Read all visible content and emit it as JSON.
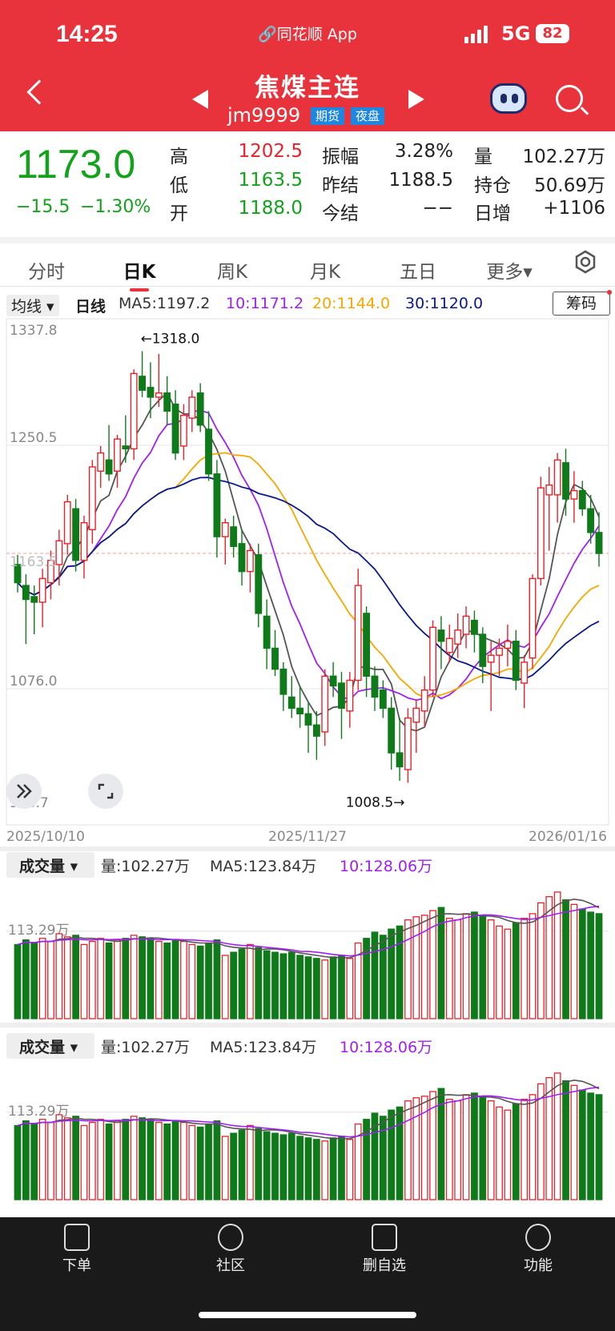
{
  "status_bar": {
    "time": "14:25",
    "app": "🔗同花顺 App",
    "network": "5G",
    "battery": "82"
  },
  "nav": {
    "title": "焦煤主连",
    "code": "jm9999",
    "tag_futures": "期货",
    "tag_night": "夜盘"
  },
  "quote": {
    "price": "1173.0",
    "change": "−15.5",
    "change_pct": "−1.30%",
    "rows": [
      {
        "l1": "高",
        "v1": "1202.5",
        "c1": "red",
        "l2": "振幅",
        "v2": "3.28%",
        "c2": "blk",
        "l3": "量",
        "v3": "102.27万",
        "c3": "blk"
      },
      {
        "l1": "低",
        "v1": "1163.5",
        "c1": "green",
        "l2": "昨结",
        "v2": "1188.5",
        "c2": "blk",
        "l3": "持仓",
        "v3": "50.69万",
        "c3": "blk"
      },
      {
        "l1": "开",
        "v1": "1188.0",
        "c1": "green",
        "l2": "今结",
        "v2": "−−",
        "c2": "blk",
        "l3": "日增",
        "v3": "+1106",
        "c3": "blk"
      }
    ]
  },
  "tabs": [
    "分时",
    "日K",
    "周K",
    "月K",
    "五日",
    "更多▾"
  ],
  "ma_bar": {
    "dropdown": "均线 ▾",
    "period": "日线",
    "ma5": "MA5:1197.2",
    "ma10": "10:1171.2",
    "ma20": "20:1144.0",
    "ma30": "30:1120.0",
    "chips": "筹码"
  },
  "colors": {
    "up": "#e8222b",
    "down": "#0f7a1a",
    "ma5": "#555555",
    "ma10": "#a020f0",
    "ma20": "#f5a800",
    "ma30": "#0a1a8a"
  },
  "chart_data": {
    "type": "candlestick",
    "ylim": [
      988.7,
      1337.8
    ],
    "y_ticks": [
      "1337.8",
      "1250.5",
      "1076.0",
      "988.7"
    ],
    "x_labels": [
      "2025/10/10",
      "2025/11/27",
      "2026/01/16"
    ],
    "annotations": {
      "high": "←1318.0",
      "low": "1008.5→",
      "last": "1163.5"
    },
    "ohlc": [
      [
        1165,
        1172,
        1145,
        1152
      ],
      [
        1150,
        1158,
        1108,
        1140
      ],
      [
        1142,
        1150,
        1115,
        1138
      ],
      [
        1138,
        1162,
        1120,
        1155
      ],
      [
        1152,
        1175,
        1140,
        1168
      ],
      [
        1165,
        1190,
        1150,
        1182
      ],
      [
        1180,
        1215,
        1172,
        1210
      ],
      [
        1205,
        1212,
        1160,
        1168
      ],
      [
        1168,
        1200,
        1155,
        1195
      ],
      [
        1190,
        1240,
        1180,
        1235
      ],
      [
        1232,
        1250,
        1220,
        1245
      ],
      [
        1240,
        1265,
        1225,
        1230
      ],
      [
        1232,
        1258,
        1220,
        1255
      ],
      [
        1250,
        1272,
        1238,
        1248
      ],
      [
        1248,
        1305,
        1240,
        1302
      ],
      [
        1300,
        1318,
        1285,
        1290
      ],
      [
        1292,
        1310,
        1270,
        1285
      ],
      [
        1285,
        1316,
        1278,
        1288
      ],
      [
        1288,
        1300,
        1265,
        1275
      ],
      [
        1280,
        1290,
        1240,
        1245
      ],
      [
        1250,
        1280,
        1240,
        1272
      ],
      [
        1270,
        1290,
        1260,
        1285
      ],
      [
        1288,
        1295,
        1260,
        1265
      ],
      [
        1262,
        1275,
        1225,
        1230
      ],
      [
        1230,
        1240,
        1170,
        1185
      ],
      [
        1185,
        1198,
        1165,
        1195
      ],
      [
        1192,
        1200,
        1170,
        1178
      ],
      [
        1180,
        1190,
        1150,
        1160
      ],
      [
        1160,
        1180,
        1145,
        1175
      ],
      [
        1172,
        1180,
        1120,
        1130
      ],
      [
        1128,
        1140,
        1090,
        1105
      ],
      [
        1105,
        1118,
        1085,
        1090
      ],
      [
        1090,
        1095,
        1060,
        1072
      ],
      [
        1070,
        1085,
        1055,
        1062
      ],
      [
        1062,
        1078,
        1048,
        1058
      ],
      [
        1058,
        1066,
        1030,
        1050
      ],
      [
        1050,
        1060,
        1025,
        1042
      ],
      [
        1045,
        1090,
        1035,
        1085
      ],
      [
        1085,
        1095,
        1070,
        1078
      ],
      [
        1080,
        1088,
        1040,
        1062
      ],
      [
        1060,
        1088,
        1048,
        1082
      ],
      [
        1082,
        1162,
        1075,
        1150
      ],
      [
        1130,
        1135,
        1070,
        1085
      ],
      [
        1085,
        1092,
        1060,
        1070
      ],
      [
        1075,
        1082,
        1055,
        1062
      ],
      [
        1062,
        1070,
        1018,
        1030
      ],
      [
        1030,
        1055,
        1010,
        1020
      ],
      [
        1018,
        1062,
        1008.5,
        1055
      ],
      [
        1052,
        1068,
        1030,
        1062
      ],
      [
        1060,
        1085,
        1048,
        1075
      ],
      [
        1075,
        1125,
        1070,
        1120
      ],
      [
        1118,
        1128,
        1090,
        1110
      ],
      [
        1102,
        1122,
        1095,
        1112
      ],
      [
        1108,
        1130,
        1098,
        1118
      ],
      [
        1115,
        1135,
        1105,
        1128
      ],
      [
        1125,
        1132,
        1102,
        1115
      ],
      [
        1115,
        1120,
        1080,
        1092
      ],
      [
        1095,
        1110,
        1060,
        1100
      ],
      [
        1100,
        1112,
        1085,
        1105
      ],
      [
        1105,
        1122,
        1092,
        1110
      ],
      [
        1110,
        1118,
        1075,
        1082
      ],
      [
        1080,
        1100,
        1062,
        1095
      ],
      [
        1098,
        1158,
        1090,
        1155
      ],
      [
        1155,
        1228,
        1150,
        1220
      ],
      [
        1215,
        1235,
        1175,
        1222
      ],
      [
        1215,
        1245,
        1195,
        1240
      ],
      [
        1238,
        1248,
        1200,
        1212
      ],
      [
        1212,
        1232,
        1195,
        1218
      ],
      [
        1218,
        1225,
        1200,
        1205
      ],
      [
        1205,
        1215,
        1180,
        1188
      ],
      [
        1188,
        1202.5,
        1163.5,
        1173
      ]
    ],
    "volume_stats": {
      "label": "成交量 ▾",
      "vol": "量:102.27万",
      "ma5": "MA5:123.84万",
      "ma10": "10:128.06万",
      "ref": "113.29万"
    },
    "volume": [
      96,
      102,
      98,
      104,
      100,
      110,
      106,
      108,
      96,
      100,
      104,
      98,
      102,
      104,
      108,
      106,
      104,
      100,
      98,
      102,
      100,
      96,
      94,
      98,
      102,
      82,
      86,
      90,
      96,
      92,
      88,
      86,
      84,
      86,
      82,
      80,
      78,
      76,
      80,
      82,
      78,
      98,
      104,
      112,
      108,
      116,
      120,
      128,
      132,
      134,
      140,
      144,
      130,
      128,
      136,
      138,
      134,
      128,
      120,
      116,
      124,
      130,
      136,
      150,
      158,
      164,
      154,
      148,
      142,
      138,
      136
    ]
  },
  "tab_bar": [
    {
      "label": "下单",
      "icon": "document-icon"
    },
    {
      "label": "社区",
      "icon": "community-icon"
    },
    {
      "label": "删自选",
      "icon": "minus-square-icon"
    },
    {
      "label": "功能",
      "icon": "menu-circle-icon"
    }
  ]
}
